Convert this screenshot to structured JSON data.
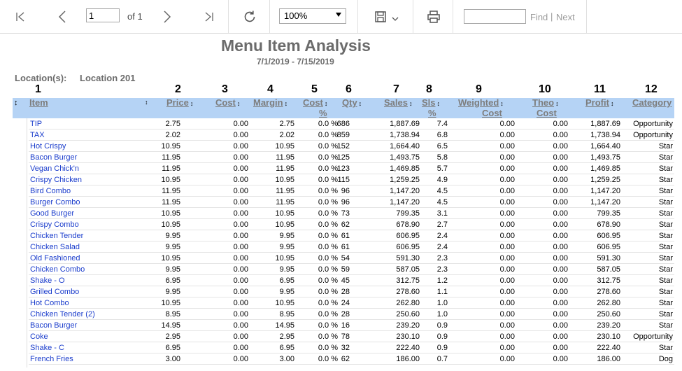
{
  "toolbar": {
    "page_value": "1",
    "page_of": "of 1",
    "zoom": "100%",
    "find_label": "Find",
    "find_sep": "|",
    "next_label": "Next",
    "icons": [
      "first-page-icon",
      "prev-page-icon",
      "next-page-icon",
      "last-page-icon",
      "refresh-icon",
      "save-icon",
      "dropdown-chevron-icon",
      "print-icon"
    ]
  },
  "report": {
    "title": "Menu Item Analysis",
    "date_range": "7/1/2019 - 7/15/2019",
    "location_label": "Location(s):",
    "location_value": "Location  201"
  },
  "columns": {
    "numbers": [
      "1",
      "2",
      "3",
      "4",
      "5",
      "6",
      "7",
      "8",
      "9",
      "10",
      "11",
      "12"
    ],
    "item": "Item",
    "price": "Price",
    "cost": "Cost",
    "margin": "Margin",
    "cost_pct_1": "Cost",
    "cost_pct_2": "%",
    "qty": "Qty",
    "sales": "Sales",
    "sls_pct_1": "Sls",
    "sls_pct_2": "%",
    "weighted_cost_1": "Weighted",
    "weighted_cost_2": "Cost",
    "theo_cost_1": "Theo",
    "theo_cost_2": "Cost",
    "profit": "Profit",
    "category": "Category",
    "sort_arrow": "↕"
  },
  "rows": [
    {
      "item": "TIP",
      "price": "2.75",
      "cost": "0.00",
      "margin": "2.75",
      "cost_pct": "0.0 %",
      "qty": "686",
      "sales": "1,887.69",
      "sls_pct": "7.4",
      "weighted_cost": "0.00",
      "theo_cost": "0.00",
      "profit": "1,887.69",
      "category": "Opportunity"
    },
    {
      "item": "TAX",
      "price": "2.02",
      "cost": "0.00",
      "margin": "2.02",
      "cost_pct": "0.0 %",
      "qty": "859",
      "sales": "1,738.94",
      "sls_pct": "6.8",
      "weighted_cost": "0.00",
      "theo_cost": "0.00",
      "profit": "1,738.94",
      "category": "Opportunity"
    },
    {
      "item": "Hot Crispy",
      "price": "10.95",
      "cost": "0.00",
      "margin": "10.95",
      "cost_pct": "0.0 %",
      "qty": "152",
      "sales": "1,664.40",
      "sls_pct": "6.5",
      "weighted_cost": "0.00",
      "theo_cost": "0.00",
      "profit": "1,664.40",
      "category": "Star"
    },
    {
      "item": "Bacon Burger",
      "price": "11.95",
      "cost": "0.00",
      "margin": "11.95",
      "cost_pct": "0.0 %",
      "qty": "125",
      "sales": "1,493.75",
      "sls_pct": "5.8",
      "weighted_cost": "0.00",
      "theo_cost": "0.00",
      "profit": "1,493.75",
      "category": "Star"
    },
    {
      "item": "Vegan Chick'n",
      "price": "11.95",
      "cost": "0.00",
      "margin": "11.95",
      "cost_pct": "0.0 %",
      "qty": "123",
      "sales": "1,469.85",
      "sls_pct": "5.7",
      "weighted_cost": "0.00",
      "theo_cost": "0.00",
      "profit": "1,469.85",
      "category": "Star"
    },
    {
      "item": "Crispy Chicken",
      "price": "10.95",
      "cost": "0.00",
      "margin": "10.95",
      "cost_pct": "0.0 %",
      "qty": "115",
      "sales": "1,259.25",
      "sls_pct": "4.9",
      "weighted_cost": "0.00",
      "theo_cost": "0.00",
      "profit": "1,259.25",
      "category": "Star"
    },
    {
      "item": "Bird Combo",
      "price": "11.95",
      "cost": "0.00",
      "margin": "11.95",
      "cost_pct": "0.0 %",
      "qty": "96",
      "sales": "1,147.20",
      "sls_pct": "4.5",
      "weighted_cost": "0.00",
      "theo_cost": "0.00",
      "profit": "1,147.20",
      "category": "Star"
    },
    {
      "item": "Burger Combo",
      "price": "11.95",
      "cost": "0.00",
      "margin": "11.95",
      "cost_pct": "0.0 %",
      "qty": "96",
      "sales": "1,147.20",
      "sls_pct": "4.5",
      "weighted_cost": "0.00",
      "theo_cost": "0.00",
      "profit": "1,147.20",
      "category": "Star"
    },
    {
      "item": "Good Burger",
      "price": "10.95",
      "cost": "0.00",
      "margin": "10.95",
      "cost_pct": "0.0 %",
      "qty": "73",
      "sales": "799.35",
      "sls_pct": "3.1",
      "weighted_cost": "0.00",
      "theo_cost": "0.00",
      "profit": "799.35",
      "category": "Star"
    },
    {
      "item": "Crispy Combo",
      "price": "10.95",
      "cost": "0.00",
      "margin": "10.95",
      "cost_pct": "0.0 %",
      "qty": "62",
      "sales": "678.90",
      "sls_pct": "2.7",
      "weighted_cost": "0.00",
      "theo_cost": "0.00",
      "profit": "678.90",
      "category": "Star"
    },
    {
      "item": "Chicken Tender",
      "price": "9.95",
      "cost": "0.00",
      "margin": "9.95",
      "cost_pct": "0.0 %",
      "qty": "61",
      "sales": "606.95",
      "sls_pct": "2.4",
      "weighted_cost": "0.00",
      "theo_cost": "0.00",
      "profit": "606.95",
      "category": "Star"
    },
    {
      "item": "Chicken Salad",
      "price": "9.95",
      "cost": "0.00",
      "margin": "9.95",
      "cost_pct": "0.0 %",
      "qty": "61",
      "sales": "606.95",
      "sls_pct": "2.4",
      "weighted_cost": "0.00",
      "theo_cost": "0.00",
      "profit": "606.95",
      "category": "Star"
    },
    {
      "item": "Old Fashioned",
      "price": "10.95",
      "cost": "0.00",
      "margin": "10.95",
      "cost_pct": "0.0 %",
      "qty": "54",
      "sales": "591.30",
      "sls_pct": "2.3",
      "weighted_cost": "0.00",
      "theo_cost": "0.00",
      "profit": "591.30",
      "category": "Star"
    },
    {
      "item": "Chicken Combo",
      "price": "9.95",
      "cost": "0.00",
      "margin": "9.95",
      "cost_pct": "0.0 %",
      "qty": "59",
      "sales": "587.05",
      "sls_pct": "2.3",
      "weighted_cost": "0.00",
      "theo_cost": "0.00",
      "profit": "587.05",
      "category": "Star"
    },
    {
      "item": "Shake - O",
      "price": "6.95",
      "cost": "0.00",
      "margin": "6.95",
      "cost_pct": "0.0 %",
      "qty": "45",
      "sales": "312.75",
      "sls_pct": "1.2",
      "weighted_cost": "0.00",
      "theo_cost": "0.00",
      "profit": "312.75",
      "category": "Star"
    },
    {
      "item": "Grilled Combo",
      "price": "9.95",
      "cost": "0.00",
      "margin": "9.95",
      "cost_pct": "0.0 %",
      "qty": "28",
      "sales": "278.60",
      "sls_pct": "1.1",
      "weighted_cost": "0.00",
      "theo_cost": "0.00",
      "profit": "278.60",
      "category": "Star"
    },
    {
      "item": "Hot Combo",
      "price": "10.95",
      "cost": "0.00",
      "margin": "10.95",
      "cost_pct": "0.0 %",
      "qty": "24",
      "sales": "262.80",
      "sls_pct": "1.0",
      "weighted_cost": "0.00",
      "theo_cost": "0.00",
      "profit": "262.80",
      "category": "Star"
    },
    {
      "item": "Chicken Tender (2)",
      "price": "8.95",
      "cost": "0.00",
      "margin": "8.95",
      "cost_pct": "0.0 %",
      "qty": "28",
      "sales": "250.60",
      "sls_pct": "1.0",
      "weighted_cost": "0.00",
      "theo_cost": "0.00",
      "profit": "250.60",
      "category": "Star"
    },
    {
      "item": "Bacon Burger",
      "price": "14.95",
      "cost": "0.00",
      "margin": "14.95",
      "cost_pct": "0.0 %",
      "qty": "16",
      "sales": "239.20",
      "sls_pct": "0.9",
      "weighted_cost": "0.00",
      "theo_cost": "0.00",
      "profit": "239.20",
      "category": "Star"
    },
    {
      "item": "Coke",
      "price": "2.95",
      "cost": "0.00",
      "margin": "2.95",
      "cost_pct": "0.0 %",
      "qty": "78",
      "sales": "230.10",
      "sls_pct": "0.9",
      "weighted_cost": "0.00",
      "theo_cost": "0.00",
      "profit": "230.10",
      "category": "Opportunity"
    },
    {
      "item": "Shake - C",
      "price": "6.95",
      "cost": "0.00",
      "margin": "6.95",
      "cost_pct": "0.0 %",
      "qty": "32",
      "sales": "222.40",
      "sls_pct": "0.9",
      "weighted_cost": "0.00",
      "theo_cost": "0.00",
      "profit": "222.40",
      "category": "Star"
    },
    {
      "item": "French Fries",
      "price": "3.00",
      "cost": "0.00",
      "margin": "3.00",
      "cost_pct": "0.0 %",
      "qty": "62",
      "sales": "186.00",
      "sls_pct": "0.7",
      "weighted_cost": "0.00",
      "theo_cost": "0.00",
      "profit": "186.00",
      "category": "Dog"
    }
  ],
  "colors": {
    "header_band": "#b5d3f5",
    "item_link": "#1a3ccc",
    "title_gray": "#6b6b6b"
  }
}
